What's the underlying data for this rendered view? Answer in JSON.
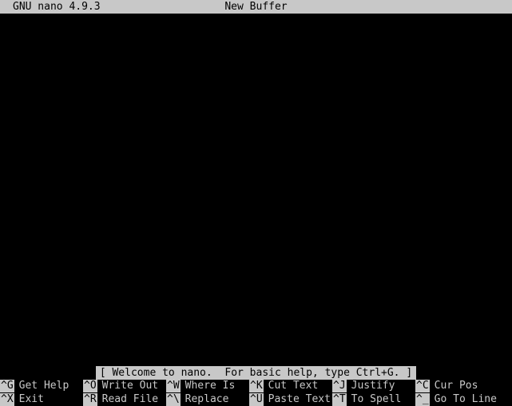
{
  "titlebar": {
    "app": "GNU nano 4.9.3",
    "buffer": "New Buffer"
  },
  "status": "[ Welcome to nano.  For basic help, type Ctrl+G. ]",
  "shortcuts": {
    "row1": [
      {
        "key": "^G",
        "label": "Get Help"
      },
      {
        "key": "^O",
        "label": "Write Out"
      },
      {
        "key": "^W",
        "label": "Where Is"
      },
      {
        "key": "^K",
        "label": "Cut Text"
      },
      {
        "key": "^J",
        "label": "Justify"
      },
      {
        "key": "^C",
        "label": "Cur Pos"
      }
    ],
    "row2": [
      {
        "key": "^X",
        "label": "Exit"
      },
      {
        "key": "^R",
        "label": "Read File"
      },
      {
        "key": "^\\",
        "label": "Replace"
      },
      {
        "key": "^U",
        "label": "Paste Text"
      },
      {
        "key": "^T",
        "label": "To Spell"
      },
      {
        "key": "^_",
        "label": "Go To Line"
      }
    ]
  },
  "colors": {
    "background": "#000000",
    "foreground": "#c8c8c8",
    "bar": "#c8c8c8",
    "bar_text": "#000000"
  }
}
